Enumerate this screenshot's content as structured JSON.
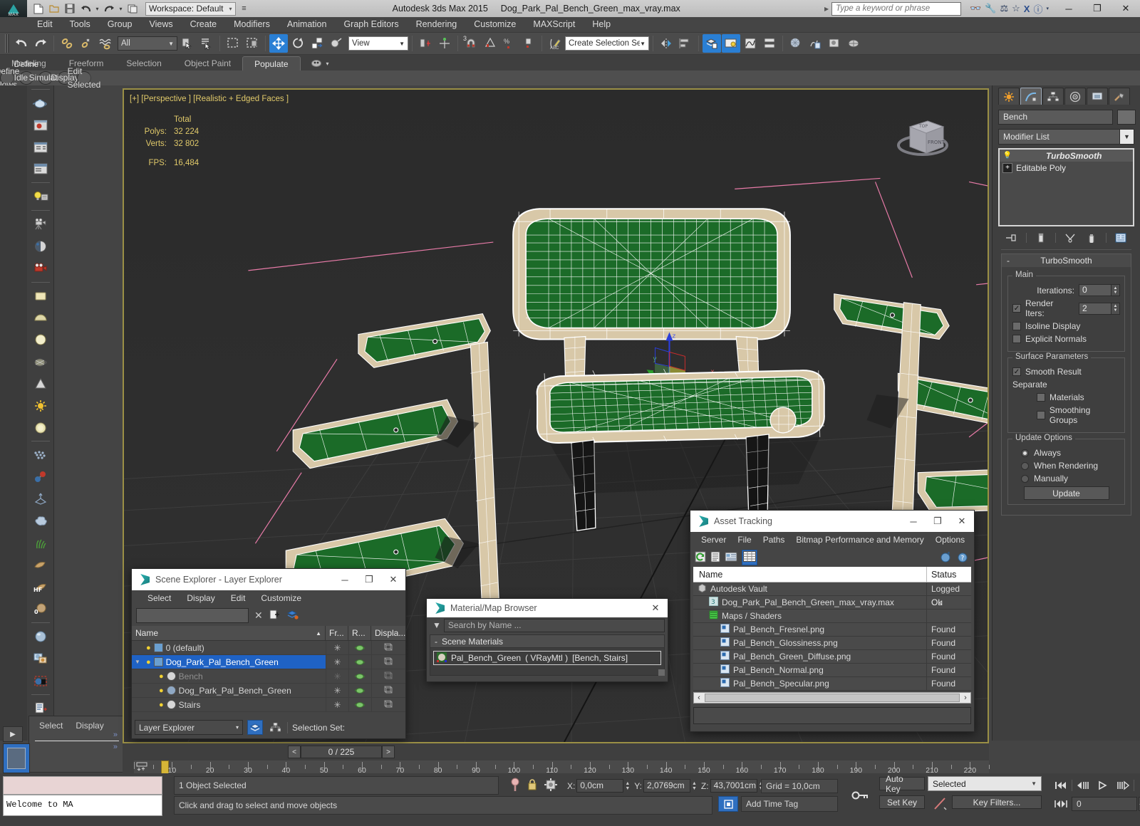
{
  "title_bar": {
    "app_title": "Autodesk 3ds Max  2015",
    "file_name": "Dog_Park_Pal_Bench_Green_max_vray.max",
    "workspace": "Workspace: Default",
    "search_placeholder": "Type a keyword or phrase",
    "quick_access": [
      "new-file-icon",
      "open-file-icon",
      "save-file-icon",
      "undo-icon",
      "redo-icon",
      "set-project-icon"
    ],
    "tool_icons": [
      "binoculars-icon",
      "wrench-icon",
      "compass-icon",
      "star-icon",
      "exchange-icon",
      "help-icon"
    ],
    "window_buttons": {
      "minimize": "─",
      "maximize": "❐",
      "close": "✕"
    },
    "logo_label": "MAX"
  },
  "menu": {
    "items": [
      "Edit",
      "Tools",
      "Group",
      "Views",
      "Create",
      "Modifiers",
      "Animation",
      "Graph Editors",
      "Rendering",
      "Customize",
      "MAXScript",
      "Help"
    ]
  },
  "main_toolbar": {
    "selection_filter": "All",
    "reference_coord": "View",
    "named_selection_set": "Create Selection Se",
    "icons": [
      "undo-icon",
      "redo-icon",
      "select-link-icon",
      "unlink-icon",
      "bind-space-warp-icon",
      "select-object-icon",
      "select-by-name-icon",
      "rect-select-region-icon",
      "window-crossing-icon",
      "select-and-move-icon",
      "select-and-rotate-icon",
      "select-and-scale-icon",
      "placement-tool-icon",
      "use-center-flyout-icon",
      "select-and-manipulate-icon",
      "snaps-toggle-icon",
      "angle-snap-icon",
      "percent-snap-icon",
      "spinner-snap-icon",
      "edit-named-selection-icon",
      "mirror-icon",
      "align-icon",
      "layer-explorer-icon",
      "scene-explorer-icon",
      "curve-editor-icon",
      "schematic-view-icon",
      "material-editor-icon",
      "render-setup-icon",
      "rendered-frame-icon",
      "render-production-icon"
    ]
  },
  "ribbon": {
    "tabs": [
      "Modeling",
      "Freeform",
      "Selection",
      "Object Paint",
      "Populate"
    ],
    "active_tab": "Populate",
    "dropdown_icon": "populate-flyout-icon",
    "sub_buttons": [
      "Define Flows",
      "Define Idle Areas",
      "Simulate",
      "Display",
      "Edit Selected"
    ]
  },
  "left_toolbar": {
    "icons": [
      "teapot-icon",
      "render-frame-icon",
      "render-setup-panel-icon",
      "render-settings-icon",
      "light-lister-icon",
      "camera-icon",
      "shaded-sphere-icon",
      "vray-camera-icon",
      "plane-primitive-icon",
      "dome-primitive-icon",
      "sphere-primitive-icon",
      "teapot-wire-icon",
      "cone-primitive-icon",
      "sun-icon",
      "sphere-light-icon",
      "particles-icon",
      "molecule-icon",
      "proxy-icon",
      "cloud-icon",
      "grass-icon",
      "fur-icon",
      "hf-icon",
      "displacement-icon",
      "material-sphere-icon",
      "map-swap-icon",
      "material-select-icon",
      "script-icon",
      "help-circle-icon"
    ]
  },
  "viewport": {
    "label": "[+] [Perspective ] [Realistic + Edged Faces ]",
    "stats": {
      "header": "Total",
      "polys_label": "Polys:",
      "polys_value": "32 224",
      "verts_label": "Verts:",
      "verts_value": "32 802",
      "fps_label": "FPS:",
      "fps_value": "16,484"
    },
    "navcube_faces": {
      "top": "TOP",
      "front": "FRONT"
    },
    "colors": {
      "background": "#2e2e2e",
      "border": "#9a8f45",
      "seat_green": "#1b6b28",
      "frame_beige": "#d8c8a8",
      "wire": "#ffffff",
      "helper_pink": "#e87ba8"
    }
  },
  "command_panel": {
    "tabs": [
      "create-tab-icon",
      "modify-tab-icon",
      "hierarchy-tab-icon",
      "motion-tab-icon",
      "display-tab-icon",
      "utilities-tab-icon"
    ],
    "active_tab_index": 1,
    "object_name": "Bench",
    "modifier_list_label": "Modifier List",
    "stack": [
      {
        "label": "TurboSmooth",
        "icon": "lightbulb-icon",
        "selected": true
      },
      {
        "label": "Editable Poly",
        "icon": "plus-box-icon",
        "selected": false
      }
    ],
    "stack_buttons": [
      "pin-stack-icon",
      "show-end-result-icon",
      "make-unique-icon",
      "remove-modifier-icon",
      "configure-sets-icon"
    ],
    "rollout": {
      "title": "TurboSmooth",
      "collapse_icon": "-",
      "main_group": "Main",
      "iterations_label": "Iterations:",
      "iterations_value": "0",
      "render_iters_label": "Render Iters:",
      "render_iters_value": "2",
      "render_iters_checked": true,
      "isoline_label": "Isoline Display",
      "isoline_checked": false,
      "explicit_label": "Explicit Normals",
      "explicit_checked": false,
      "surface_group": "Surface Parameters",
      "smooth_result_label": "Smooth Result",
      "smooth_result_checked": true,
      "separate_label": "Separate",
      "materials_label": "Materials",
      "materials_checked": false,
      "smoothing_groups_label": "Smoothing Groups",
      "smoothing_groups_checked": false,
      "update_group": "Update Options",
      "update_options": [
        "Always",
        "When Rendering",
        "Manually"
      ],
      "update_selected": "Always",
      "update_button": "Update"
    }
  },
  "scene_explorer": {
    "title": "Scene Explorer - Layer Explorer",
    "menu": [
      "Select",
      "Display",
      "Edit",
      "Customize"
    ],
    "search_value": "",
    "toolbar_icons": [
      "clear-search-icon",
      "new-layer-icon",
      "layer-options-icon"
    ],
    "columns": [
      "Name",
      "Fr...",
      "R...",
      "Displa..."
    ],
    "sort_indicator": "▲",
    "rows": [
      {
        "name": "0 (default)",
        "indent": 1,
        "icon": "layer-icon",
        "selected": false,
        "dim": false,
        "expander": ""
      },
      {
        "name": "Dog_Park_Pal_Bench_Green",
        "indent": 1,
        "icon": "layer-icon",
        "selected": true,
        "dim": false,
        "expander": "▼"
      },
      {
        "name": "Bench",
        "indent": 2,
        "icon": "object-icon",
        "selected": false,
        "dim": true,
        "expander": ""
      },
      {
        "name": "Dog_Park_Pal_Bench_Green",
        "indent": 2,
        "icon": "group-icon",
        "selected": false,
        "dim": false,
        "expander": ""
      },
      {
        "name": "Stairs",
        "indent": 2,
        "icon": "object-icon",
        "selected": false,
        "dim": false,
        "expander": ""
      }
    ],
    "footer_dropdown": "Layer Explorer",
    "footer_icons": [
      "layer-explorer-mode-icon",
      "scene-explorer-mode-icon"
    ],
    "selection_set_label": "Selection Set:"
  },
  "material_browser": {
    "title": "Material/Map Browser",
    "search_placeholder": "Search by Name ...",
    "group_label": "Scene Materials",
    "group_collapse": "-",
    "entries": [
      {
        "name": "Pal_Bench_Green",
        "type": "( VRayMtl )",
        "assigned": "[Bench, Stairs]"
      }
    ]
  },
  "asset_tracking": {
    "title": "Asset Tracking",
    "menu": [
      "Server",
      "File",
      "Paths",
      "Bitmap Performance and Memory",
      "Options"
    ],
    "toolbar_icons": [
      "refresh-icon",
      "list-view-icon",
      "details-view-icon",
      "table-view-icon"
    ],
    "right_icons": [
      "vault-check-icon",
      "vault-help-icon"
    ],
    "columns": {
      "name": "Name",
      "status": "Status"
    },
    "rows": [
      {
        "name": "Autodesk Vault",
        "status": "Logged Ou",
        "indent": 1,
        "icon": "vault-icon"
      },
      {
        "name": "Dog_Park_Pal_Bench_Green_max_vray.max",
        "status": "Ok",
        "indent": 2,
        "icon": "max-file-icon"
      },
      {
        "name": "Maps / Shaders",
        "status": "",
        "indent": 2,
        "icon": "maps-icon"
      },
      {
        "name": "Pal_Bench_Fresnel.png",
        "status": "Found",
        "indent": 3,
        "icon": "bitmap-icon"
      },
      {
        "name": "Pal_Bench_Glossiness.png",
        "status": "Found",
        "indent": 3,
        "icon": "bitmap-icon"
      },
      {
        "name": "Pal_Bench_Green_Diffuse.png",
        "status": "Found",
        "indent": 3,
        "icon": "bitmap-icon"
      },
      {
        "name": "Pal_Bench_Normal.png",
        "status": "Found",
        "indent": 3,
        "icon": "bitmap-icon"
      },
      {
        "name": "Pal_Bench_Specular.png",
        "status": "Found",
        "indent": 3,
        "icon": "bitmap-icon"
      }
    ],
    "scroll_left_arrow": "‹",
    "scroll_right_arrow": "›"
  },
  "time_slider": {
    "current": "0 / 225",
    "prev_arrow": "<",
    "next_arrow": ">",
    "tick_labels": [
      "10",
      "20",
      "30",
      "40",
      "50",
      "60",
      "70",
      "80",
      "90",
      "100",
      "110",
      "120",
      "130",
      "140",
      "150",
      "160",
      "170",
      "180",
      "190",
      "200",
      "210",
      "220"
    ],
    "start": 0,
    "end": 225
  },
  "status_bar": {
    "maxscript_prompt": "Welcome to MA",
    "selection_status": "1 Object Selected",
    "prompt": "Click and drag to select and move objects",
    "coords": {
      "x_label": "X:",
      "x_value": "0,0cm",
      "y_label": "Y:",
      "y_value": "2,0769cm",
      "z_label": "Z:",
      "z_value": "43,7001cm"
    },
    "grid_label": "Grid = 10,0cm",
    "add_time_tag": "Add Time Tag",
    "auto_key": "Auto Key",
    "set_key": "Set Key",
    "key_mode": "Selected",
    "key_filters": "Key Filters...",
    "key_frame_value": "0",
    "nav_icons": [
      "zoom-icon",
      "zoom-all-icon",
      "zoom-extents-icon",
      "zoom-extents-all-icon",
      "field-of-view-icon",
      "pan-icon",
      "orbit-icon",
      "maximize-viewport-icon"
    ],
    "playback_icons": [
      "goto-start-icon",
      "prev-frame-icon",
      "play-icon",
      "next-frame-icon",
      "goto-end-icon"
    ],
    "lock_icon": "selection-lock-icon",
    "absolute_mode_icon": "absolute-relative-icon",
    "pin_icon": "isolate-icon",
    "key_icon": "key-icon"
  }
}
